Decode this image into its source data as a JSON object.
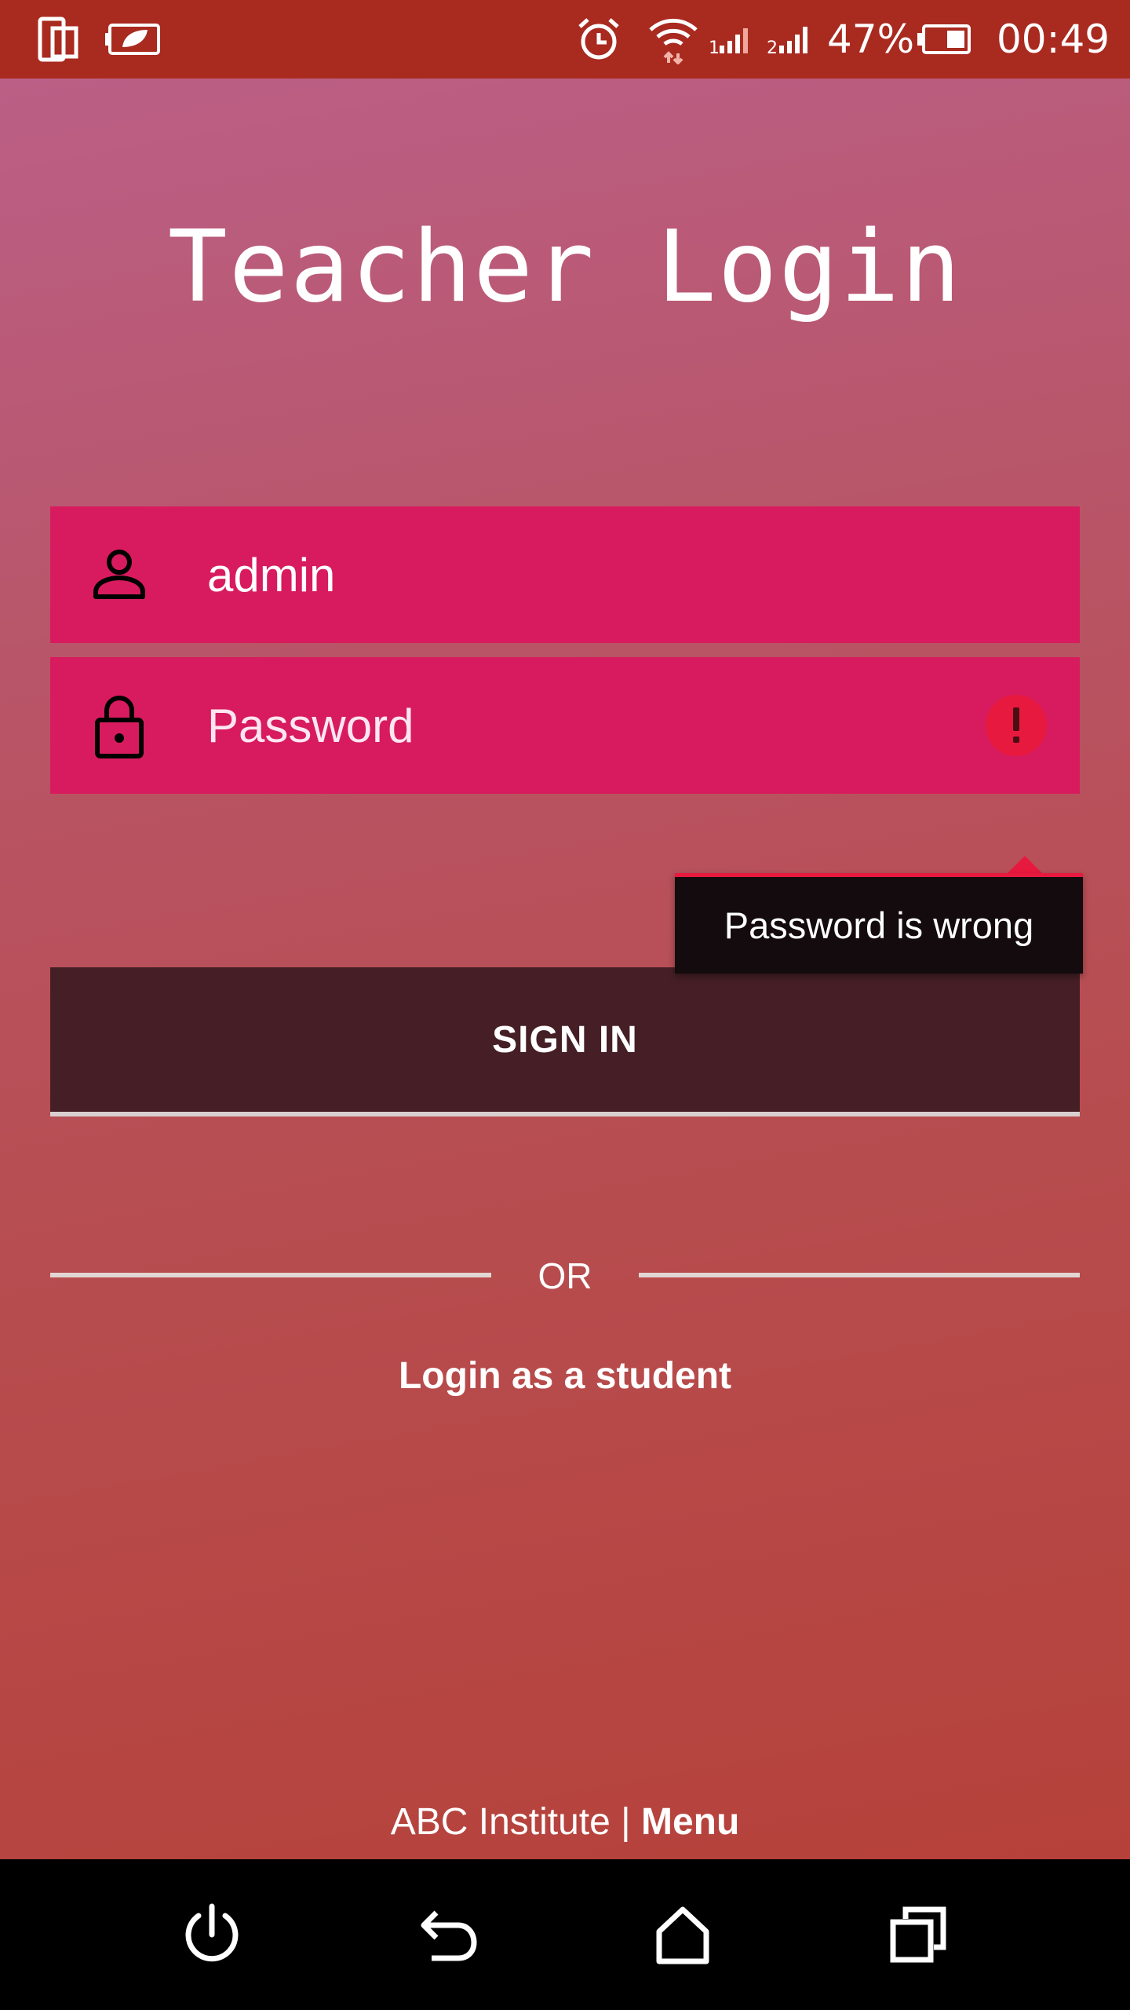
{
  "status_bar": {
    "battery_percent": "47%",
    "time": "00:49",
    "icons": [
      "phone-dual-screen-icon",
      "battery-leaf-icon",
      "alarm-clock-icon",
      "wifi-icon",
      "signal-1-icon",
      "signal-2-icon",
      "battery-icon"
    ]
  },
  "page": {
    "title": "Teacher Login"
  },
  "form": {
    "username": {
      "value": "admin",
      "icon": "user-icon"
    },
    "password": {
      "placeholder": "Password",
      "icon": "lock-icon",
      "error_icon": "error-icon",
      "error_message": "Password is wrong"
    },
    "sign_in_label": "SIGN IN",
    "or_label": "OR",
    "student_login_label": "Login as a student"
  },
  "footer": {
    "institute": "ABC Institute | ",
    "menu_label": "Menu"
  },
  "nav_bar": {
    "icons": [
      "power-icon",
      "back-icon",
      "home-icon",
      "recent-apps-icon"
    ]
  },
  "colors": {
    "status_bar": "#a92a1f",
    "field_background": "#d81b5e",
    "sign_in_button": "#451f25",
    "tooltip_background": "#130b0d",
    "error_accent": "#e8193f"
  }
}
